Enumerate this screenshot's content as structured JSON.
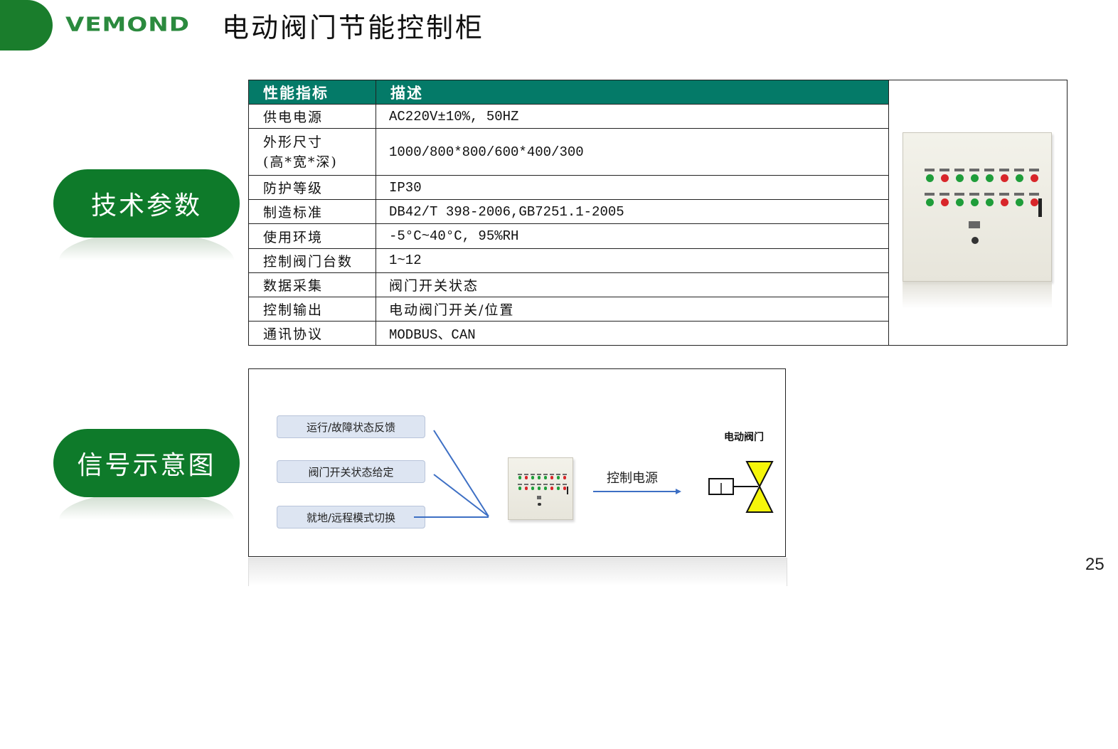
{
  "header": {
    "logo_text": "VEMOND",
    "title": "电动阀门节能控制柜"
  },
  "sections": {
    "tech_params": "技术参数",
    "signal_diagram": "信号示意图"
  },
  "spec_table": {
    "headers": [
      "性能指标",
      "描述"
    ],
    "rows": [
      {
        "param": "供电电源",
        "desc": "AC220V±10%, 50HZ"
      },
      {
        "param": "外形尺寸\n(高*宽*深)",
        "desc": "1000/800*800/600*400/300"
      },
      {
        "param": "防护等级",
        "desc": "IP30"
      },
      {
        "param": "制造标准",
        "desc": "DB42/T 398-2006,GB7251.1-2005"
      },
      {
        "param": "使用环境",
        "desc": "-5°C~40°C, 95%RH"
      },
      {
        "param": "控制阀门台数",
        "desc": "1~12"
      },
      {
        "param": "数据采集",
        "desc": "阀门开关状态"
      },
      {
        "param": "控制输出",
        "desc": "电动阀门开关/位置"
      },
      {
        "param": "通讯协议",
        "desc": "MODBUS、CAN"
      }
    ]
  },
  "diagram": {
    "signals": [
      "运行/故障状态反馈",
      "阀门开关状态给定",
      "就地/远程模式切换"
    ],
    "arrow_label": "控制电源",
    "valve_label": "电动阀门"
  },
  "cabinet": {
    "icon": "control-cabinet",
    "lamp_colors": [
      "#1f9d3a",
      "#d8262a",
      "#1f9d3a",
      "#1f9d3a",
      "#1f9d3a",
      "#d8262a",
      "#1f9d3a",
      "#d8262a"
    ]
  },
  "colors": {
    "brand_green": "#0e7a2a",
    "table_header": "#047a68",
    "arrow_blue": "#3d6fc4",
    "valve_yellow": "#f5f50a"
  },
  "page_number": "25"
}
